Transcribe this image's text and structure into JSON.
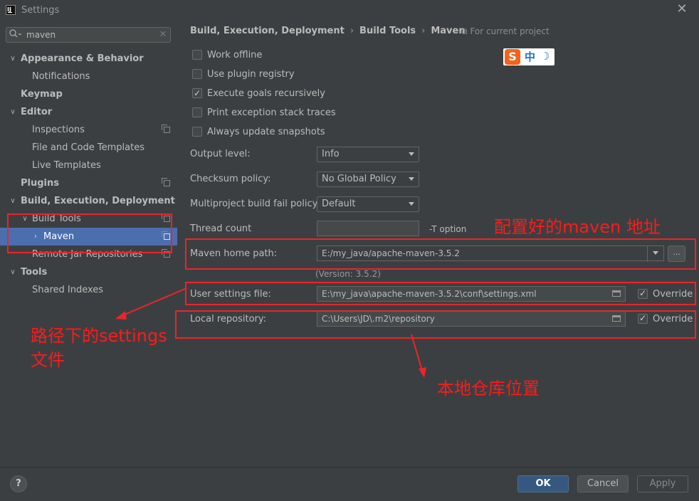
{
  "window": {
    "title": "Settings",
    "close_label": "✕",
    "logo_text": "IJ"
  },
  "search": {
    "value": "maven",
    "clear_label": "✕",
    "icon": "search-icon"
  },
  "sidebar": {
    "items": [
      {
        "label": "Appearance & Behavior",
        "arrow": "∨"
      },
      {
        "label": "Notifications"
      },
      {
        "label": "Keymap"
      },
      {
        "label": "Editor",
        "arrow": "∨"
      },
      {
        "label": "Inspections"
      },
      {
        "label": "File and Code Templates"
      },
      {
        "label": "Live Templates"
      },
      {
        "label": "Plugins"
      },
      {
        "label": "Build, Execution, Deployment",
        "arrow": "∨"
      },
      {
        "label": "Build Tools",
        "arrow": "∨"
      },
      {
        "label": "Maven",
        "arrow": "›"
      },
      {
        "label": "Remote Jar Repositories"
      },
      {
        "label": "Tools",
        "arrow": "∨"
      },
      {
        "label": "Shared Indexes"
      }
    ]
  },
  "breadcrumb": {
    "part1": "Build, Execution, Deployment",
    "part2": "Build Tools",
    "part3": "Maven",
    "sep": "›"
  },
  "for_project": "⧉ For current project",
  "checkboxes": [
    {
      "label": "Work offline",
      "checked": false
    },
    {
      "label": "Use plugin registry",
      "checked": false
    },
    {
      "label": "Execute goals recursively",
      "checked": true
    },
    {
      "label": "Print exception stack traces",
      "checked": false
    },
    {
      "label": "Always update snapshots",
      "checked": false
    }
  ],
  "fields": {
    "output_level": {
      "label": "Output level:",
      "value": "Info"
    },
    "checksum_policy": {
      "label": "Checksum policy:",
      "value": "No Global Policy"
    },
    "multiproject": {
      "label": "Multiproject build fail policy:",
      "value": "Default"
    },
    "thread_count": {
      "label": "Thread count",
      "value": "",
      "suffix": "-T option"
    },
    "maven_home": {
      "label": "Maven home path:",
      "value": "E:/my_java/apache-maven-3.5.2",
      "version": "(Version: 3.5.2)",
      "browse": "..."
    },
    "user_settings": {
      "label": "User settings file:",
      "value": "E:\\my_java\\apache-maven-3.5.2\\conf\\settings.xml",
      "override": "Override"
    },
    "local_repo": {
      "label": "Local repository:",
      "value": "C:\\Users\\JD\\.m2\\repository",
      "override": "Override"
    }
  },
  "annotations": {
    "maven_address": "配置好的maven 地址",
    "settings_file_line1": "路径下的settings",
    "settings_file_line2": "文件",
    "local_repo": "本地仓库位置",
    "color": "#e8262a"
  },
  "ime": {
    "s": "S",
    "zh": "中",
    "moon": "☽"
  },
  "buttons": {
    "help": "?",
    "ok": "OK",
    "cancel": "Cancel",
    "apply": "Apply"
  }
}
